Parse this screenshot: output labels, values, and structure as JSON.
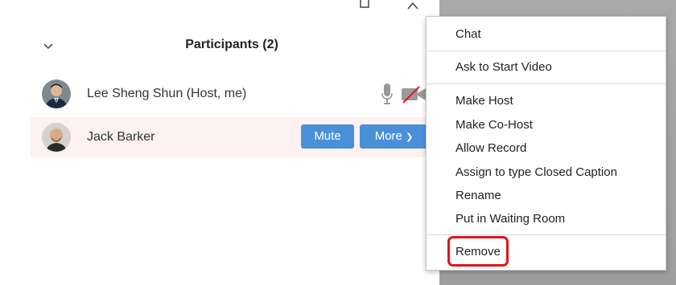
{
  "panel": {
    "title": "Participants (2)"
  },
  "participants": [
    {
      "name": "Lee Sheng Shun (Host, me)"
    },
    {
      "name": "Jack Barker",
      "mute_label": "Mute",
      "more_label": "More",
      "more_chevron": "❯"
    }
  ],
  "context_menu": {
    "items": [
      "Chat",
      "Ask to Start Video",
      "Make Host",
      "Make Co-Host",
      "Allow Record",
      "Assign to type Closed Caption",
      "Rename",
      "Put in Waiting Room",
      "Remove"
    ],
    "highlighted_item": "Remove",
    "highlight_color": "#e0141e"
  },
  "colors": {
    "button_blue": "#4a90d9",
    "selected_row": "#fdf1f1",
    "video_off_slash": "#e0141e"
  },
  "icons": [
    "maximize-icon",
    "close-icon",
    "collapse-chevron-icon",
    "microphone-icon",
    "video-off-icon"
  ]
}
